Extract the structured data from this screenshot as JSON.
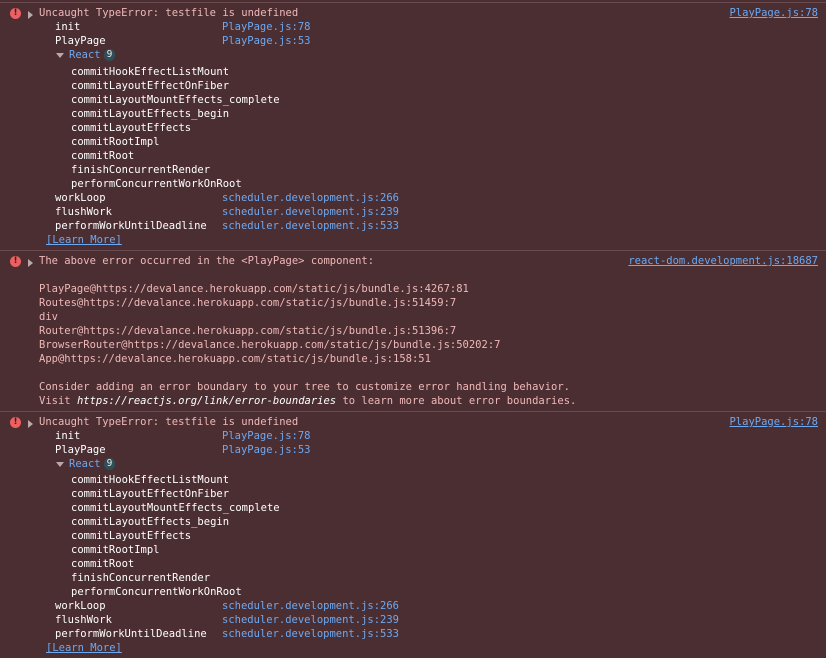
{
  "error1": {
    "message": "Uncaught TypeError: testfile is undefined",
    "source": "PlayPage.js:78",
    "frames_top": [
      {
        "name": "init",
        "loc": "PlayPage.js:78"
      },
      {
        "name": "PlayPage",
        "loc": "PlayPage.js:53"
      }
    ],
    "react_label": "React",
    "react_count": "9",
    "react_frames": [
      "commitHookEffectListMount",
      "commitLayoutEffectOnFiber",
      "commitLayoutMountEffects_complete",
      "commitLayoutEffects_begin",
      "commitLayoutEffects",
      "commitRootImpl",
      "commitRoot",
      "finishConcurrentRender",
      "performConcurrentWorkOnRoot"
    ],
    "frames_bottom": [
      {
        "name": "workLoop",
        "loc": "scheduler.development.js:266"
      },
      {
        "name": "flushWork",
        "loc": "scheduler.development.js:239"
      },
      {
        "name": "performWorkUntilDeadline",
        "loc": "scheduler.development.js:533"
      }
    ],
    "learn_more": "[Learn More]"
  },
  "error2": {
    "message": "The above error occurred in the <PlayPage> component:",
    "source": "react-dom.development.js:18687",
    "stack": [
      "PlayPage@https://devalance.herokuapp.com/static/js/bundle.js:4267:81",
      "Routes@https://devalance.herokuapp.com/static/js/bundle.js:51459:7",
      "div",
      "Router@https://devalance.herokuapp.com/static/js/bundle.js:51396:7",
      "BrowserRouter@https://devalance.herokuapp.com/static/js/bundle.js:50202:7",
      "App@https://devalance.herokuapp.com/static/js/bundle.js:158:51"
    ],
    "advice": "Consider adding an error boundary to your tree to customize error handling behavior.",
    "visit_prefix": "Visit ",
    "visit_url": "https://reactjs.org/link/error-boundaries",
    "visit_suffix": " to learn more about error boundaries."
  },
  "error3": {
    "message": "Uncaught TypeError: testfile is undefined",
    "source": "PlayPage.js:78",
    "frames_top": [
      {
        "name": "init",
        "loc": "PlayPage.js:78"
      },
      {
        "name": "PlayPage",
        "loc": "PlayPage.js:53"
      }
    ],
    "react_label": "React",
    "react_count": "9",
    "react_frames": [
      "commitHookEffectListMount",
      "commitLayoutEffectOnFiber",
      "commitLayoutMountEffects_complete",
      "commitLayoutEffects_begin",
      "commitLayoutEffects",
      "commitRootImpl",
      "commitRoot",
      "finishConcurrentRender",
      "performConcurrentWorkOnRoot"
    ],
    "frames_bottom": [
      {
        "name": "workLoop",
        "loc": "scheduler.development.js:266"
      },
      {
        "name": "flushWork",
        "loc": "scheduler.development.js:239"
      },
      {
        "name": "performWorkUntilDeadline",
        "loc": "scheduler.development.js:533"
      }
    ],
    "learn_more": "[Learn More]"
  },
  "colors": {
    "background": "#4a2e32",
    "error_text": "#f0b8b8",
    "link": "#6ea8f0",
    "error_icon": "#ee6060"
  },
  "icons": {
    "error": "error-icon",
    "expand": "expand-triangle-icon",
    "collapse": "collapse-triangle-icon"
  }
}
